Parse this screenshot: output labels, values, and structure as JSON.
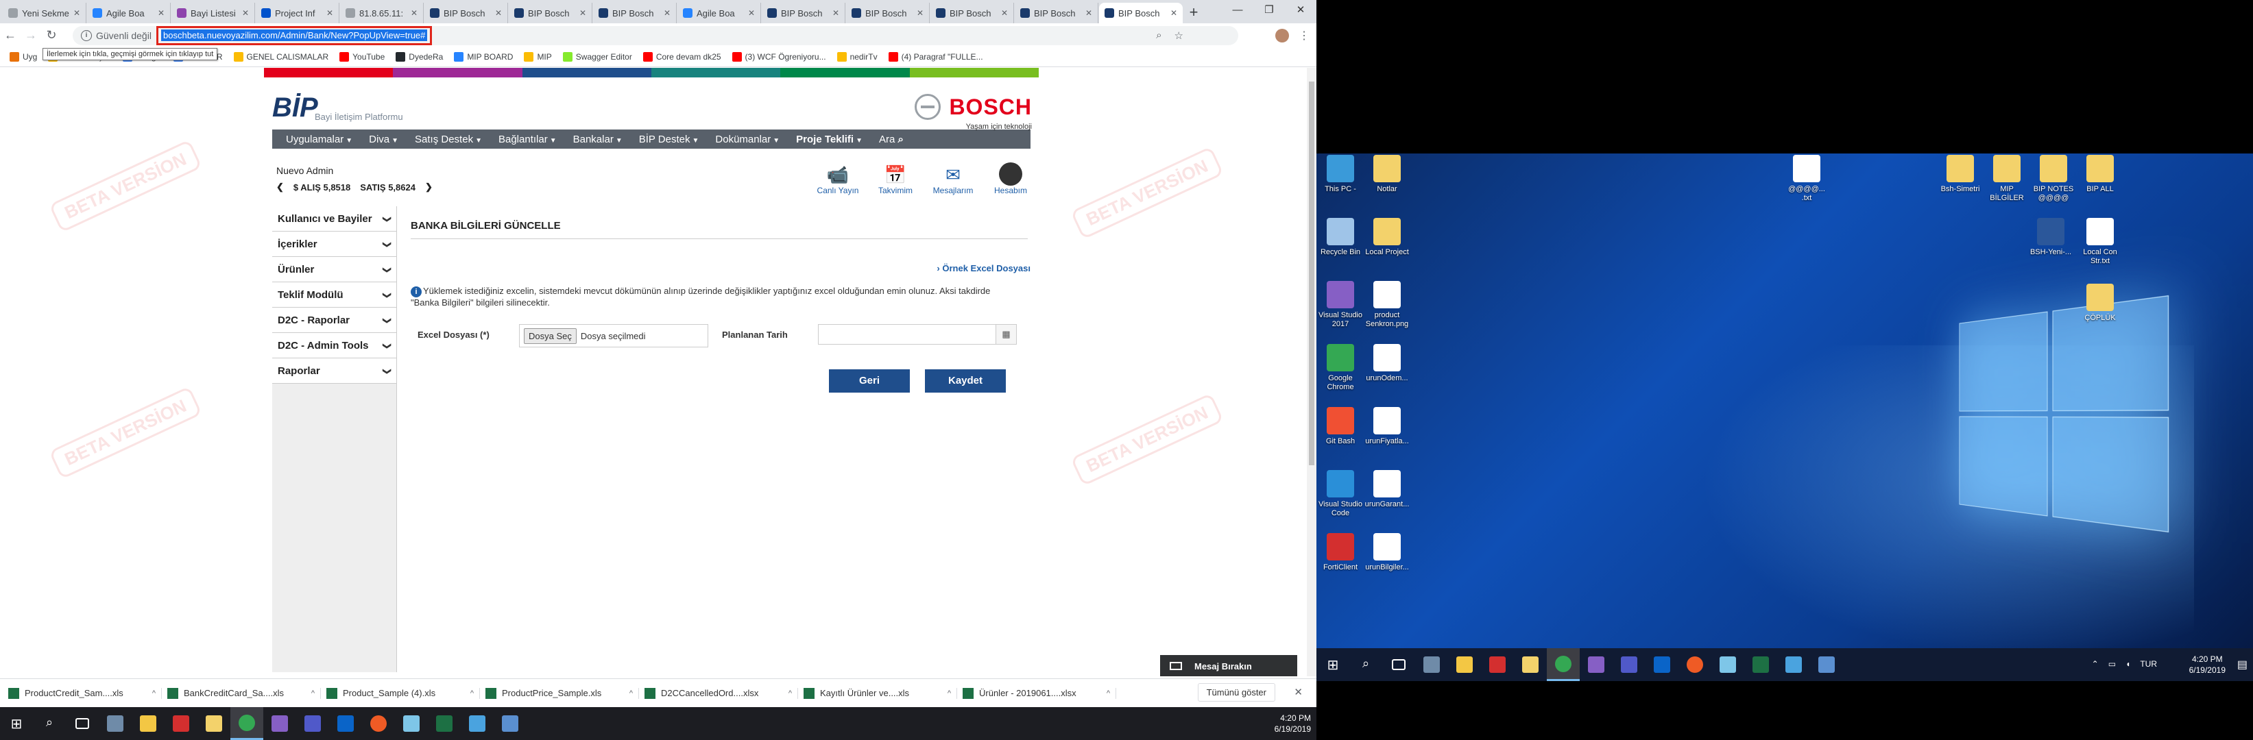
{
  "browser": {
    "tabs": [
      {
        "title": "Yeni Sekme",
        "color": "#9aa0a6",
        "active": false
      },
      {
        "title": "Agile Boa",
        "color": "#2684ff",
        "active": false
      },
      {
        "title": "Bayi Listesi",
        "color": "#8e44ad",
        "active": false
      },
      {
        "title": "Project Inf",
        "color": "#0052cc",
        "active": false
      },
      {
        "title": "81.8.65.11:",
        "color": "#9aa0a6",
        "active": false
      },
      {
        "title": "BIP Bosch",
        "color": "#1a3a6b",
        "active": false
      },
      {
        "title": "BIP Bosch",
        "color": "#1a3a6b",
        "active": false
      },
      {
        "title": "BIP Bosch",
        "color": "#1a3a6b",
        "active": false
      },
      {
        "title": "Agile Boa",
        "color": "#2684ff",
        "active": false
      },
      {
        "title": "BIP Bosch",
        "color": "#1a3a6b",
        "active": false
      },
      {
        "title": "BIP Bosch",
        "color": "#1a3a6b",
        "active": false
      },
      {
        "title": "BIP Bosch",
        "color": "#1a3a6b",
        "active": false
      },
      {
        "title": "BIP Bosch",
        "color": "#1a3a6b",
        "active": false
      },
      {
        "title": "BIP Bosch",
        "color": "#1a3a6b",
        "active": true
      }
    ],
    "new_tab": "+",
    "security_label": "Güvenli değil",
    "url": "boschbeta.nuevoyazilim.com/Admin/Bank/New?PopUpView=true#",
    "tooltip": "İlerlemek için tıkla, geçmişi görmek için tıklayıp tut",
    "bookmarks": [
      {
        "label": "Uyg",
        "color": "#e8710a"
      },
      {
        "label": "HIZLI ERİŞİM",
        "color": "#fbbc04"
      },
      {
        "label": "Google",
        "color": "#4285f4"
      },
      {
        "label": "ENG - TR",
        "color": "#4285f4"
      },
      {
        "label": "GENEL CALISMALAR",
        "color": "#fbbc04"
      },
      {
        "label": "YouTube",
        "color": "#ff0000"
      },
      {
        "label": "DyedeRa",
        "color": "#24292e"
      },
      {
        "label": "MIP BOARD",
        "color": "#2684ff"
      },
      {
        "label": "MIP",
        "color": "#fbbc04"
      },
      {
        "label": "Swagger Editor",
        "color": "#85ea2d"
      },
      {
        "label": "Core devam dk25",
        "color": "#ff0000"
      },
      {
        "label": "(3) WCF Ögreniyoru...",
        "color": "#ff0000"
      },
      {
        "label": "nedirTv",
        "color": "#fbbc04"
      },
      {
        "label": "(4) Paragraf \"FULLE...",
        "color": "#ff0000"
      }
    ]
  },
  "site": {
    "subtitle": "Bayi İletişim Platformu",
    "brand": "BOSCH",
    "brand_tag": "Yaşam için teknoloji",
    "nav": [
      {
        "label": "Uygulamalar",
        "bold": false
      },
      {
        "label": "Diva",
        "bold": false
      },
      {
        "label": "Satış Destek",
        "bold": false
      },
      {
        "label": "Bağlantılar",
        "bold": false
      },
      {
        "label": "Bankalar",
        "bold": false
      },
      {
        "label": "BİP Destek",
        "bold": false
      },
      {
        "label": "Dokümanlar",
        "bold": false
      },
      {
        "label": "Proje Teklifi",
        "bold": true
      }
    ],
    "search_label": "Ara",
    "user_name": "Nuevo Admin",
    "buy_rate": "$ ALIŞ 5,8518",
    "sell_rate": "SATIŞ 5,8624",
    "quick_links": [
      {
        "label": "Canlı Yayın",
        "icon": "broadcast-icon"
      },
      {
        "label": "Takvimim",
        "icon": "calendar-icon"
      },
      {
        "label": "Mesajlarım",
        "icon": "envelope-icon"
      },
      {
        "label": "Hesabım",
        "icon": "account-icon"
      }
    ],
    "sidebar": [
      {
        "label": "Kullanıcı ve Bayiler"
      },
      {
        "label": "İçerikler"
      },
      {
        "label": "Ürünler"
      },
      {
        "label": "Teklif Modülü"
      },
      {
        "label": "D2C - Raporlar"
      },
      {
        "label": "D2C - Admin Tools"
      },
      {
        "label": "Raporlar"
      }
    ],
    "page_title": "BANKA BİLGİLERİ GÜNCELLE",
    "sample_link": "Örnek Excel Dosyası",
    "notice": "Yüklemek istediğiniz excelin, sistemdeki mevcut dökümünün alınıp üzerinde değişiklikler yaptığınız excel olduğundan emin olunuz. Aksi takdirde \"Banka Bilgileri\" bilgileri silinecektir.",
    "excel_label": "Excel Dosyası (*)",
    "file_button": "Dosya Seç",
    "file_status": "Dosya seçilmedi",
    "date_label": "Planlanan Tarih",
    "date_value": "",
    "back_button": "Geri",
    "save_button": "Kaydet",
    "watermark": "BETA VERSİON",
    "chat_label": "Mesaj Bırakın"
  },
  "downloads": {
    "items": [
      "ProductCredit_Sam....xls",
      "BankCreditCard_Sa....xls",
      "Product_Sample (4).xls",
      "ProductPrice_Sample.xls",
      "D2CCancelledOrd....xlsx",
      "Kayıtlı Ürünler ve....xls",
      "Ürünler - 2019061....xlsx"
    ],
    "show_all": "Tümünü göster"
  },
  "left_clock": {
    "time": "4:20 PM",
    "date": "6/19/2019"
  },
  "desktop": {
    "left_icons": [
      {
        "label": "This PC -",
        "color": "#3a9ad9"
      },
      {
        "label": "Notlar",
        "color": "#f3d26b"
      },
      {
        "label": "Recycle Bin",
        "color": "#9fc4e8"
      },
      {
        "label": "Local Project",
        "color": "#f3d26b"
      },
      {
        "label": "Visual Studio 2017",
        "color": "#865fc5"
      },
      {
        "label": "product Senkron.png",
        "color": "#ffffff"
      },
      {
        "label": "Google Chrome",
        "color": "#34a853"
      },
      {
        "label": "urunOdem...",
        "color": "#ffffff"
      },
      {
        "label": "Git Bash",
        "color": "#f05033"
      },
      {
        "label": "urunFiyatla...",
        "color": "#ffffff"
      },
      {
        "label": "Visual Studio Code",
        "color": "#2a8fd8"
      },
      {
        "label": "urunGarant...",
        "color": "#ffffff"
      },
      {
        "label": "FortiClient",
        "color": "#d32f2f"
      },
      {
        "label": "urunBilgiler...",
        "color": "#ffffff"
      }
    ],
    "right_icons": [
      {
        "label": "@@@@... .txt",
        "color": "#ffffff"
      },
      {
        "label": "Bsh-Simetri",
        "color": "#f3d26b"
      },
      {
        "label": "MIP BİLGİLER",
        "color": "#f3d26b"
      },
      {
        "label": "BIP NOTES @@@@",
        "color": "#f3d26b"
      },
      {
        "label": "BIP ALL",
        "color": "#f3d26b"
      },
      {
        "label": "BSH-Yeni-...",
        "color": "#2b579a"
      },
      {
        "label": "Local Con Str.txt",
        "color": "#ffffff"
      },
      {
        "label": "ÇÖPLÜK",
        "color": "#f3d26b"
      }
    ],
    "tray_lang": "TUR",
    "clock": {
      "time": "4:20 PM",
      "date": "6/19/2019"
    }
  }
}
